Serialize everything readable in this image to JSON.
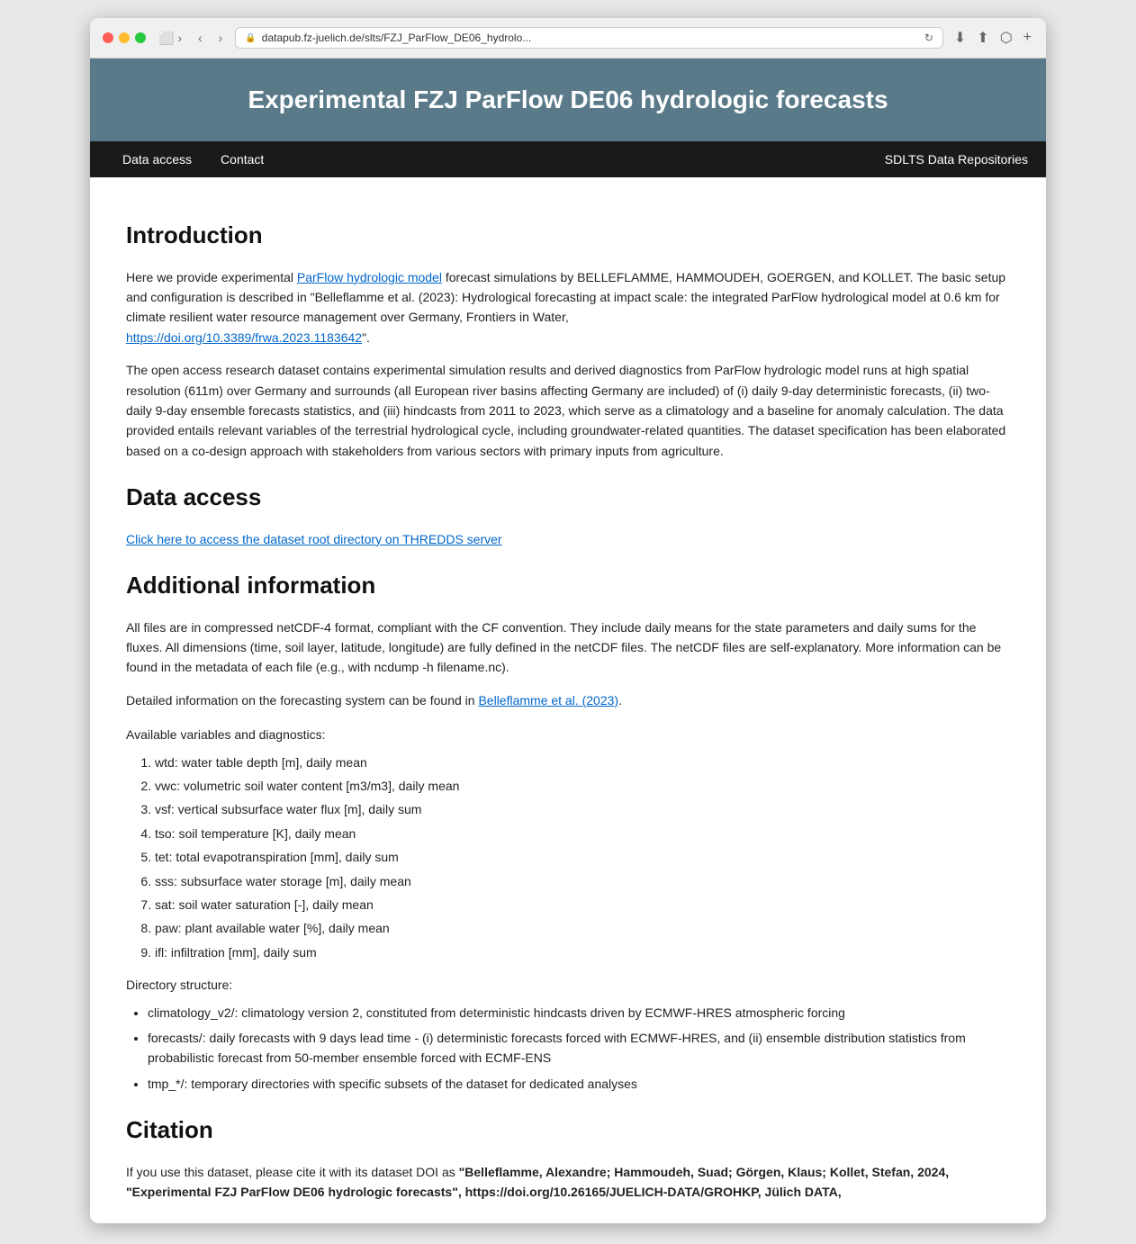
{
  "browser": {
    "url": "datapub.fz-juelich.de/slts/FZJ_ParFlow_DE06_hydrolo...",
    "back_label": "‹",
    "forward_label": "›",
    "home_label": "⌂",
    "history_label": "◷",
    "tab_label": "⬜",
    "download_label": "⬇",
    "share_label": "⬆",
    "copy_label": "⬡",
    "add_label": "+"
  },
  "page": {
    "title": "Experimental FZJ ParFlow DE06 hydrologic forecasts"
  },
  "nav": {
    "links": [
      {
        "label": "Data access"
      },
      {
        "label": "Contact"
      }
    ],
    "right": "SDLTS Data Repositories"
  },
  "sections": {
    "introduction": {
      "heading": "Introduction",
      "paragraph1_before": "Here we provide experimental ",
      "parflow_link": "ParFlow hydrologic model",
      "paragraph1_after": " forecast simulations by BELLEFLAMME, HAMMOUDEH, GOERGEN, and KOLLET. The basic setup and configuration is described in \"Belleflamme et al. (2023): Hydrological forecasting at impact scale: the integrated ParFlow hydrological model at 0.6 km for climate resilient water resource management over Germany, Frontiers in Water,",
      "doi_link": "https://doi.org/10.3389/frwa.2023.1183642",
      "paragraph1_end": "\".",
      "paragraph2": "The open access research dataset contains experimental simulation results and derived diagnostics from ParFlow hydrologic model runs at high spatial resolution (611m) over Germany and surrounds (all European river basins affecting Germany are included) of (i) daily 9-day deterministic forecasts, (ii) two-daily 9-day ensemble forecasts statistics, and (iii) hindcasts from 2011 to 2023, which serve as a climatology and a baseline for anomaly calculation. The data provided entails relevant variables of the terrestrial hydrological cycle, including groundwater-related quantities. The dataset specification has been elaborated based on a co-design approach with stakeholders from various sectors with primary inputs from agriculture."
    },
    "data_access": {
      "heading": "Data access",
      "link": "Click here to access the dataset root directory on THREDDS server"
    },
    "additional_info": {
      "heading": "Additional information",
      "paragraph1": "All files are in compressed netCDF-4 format, compliant with the CF convention. They include daily means for the state parameters and daily sums for the fluxes. All dimensions (time, soil layer, latitude, longitude) are fully defined in the netCDF files. The netCDF files are self-explanatory. More information can be found in the metadata of each file (e.g., with ncdump -h filename.nc).",
      "paragraph2_before": "Detailed information on the forecasting system can be found in ",
      "belleflamme_link": "Belleflamme et al. (2023)",
      "paragraph2_end": ".",
      "variables_label": "Available variables and diagnostics:",
      "variables": [
        "wtd: water table depth [m], daily mean",
        "vwc: volumetric soil water content [m3/m3], daily mean",
        "vsf: vertical subsurface water flux [m], daily sum",
        "tso: soil temperature [K], daily mean",
        "tet: total evapotranspiration [mm], daily sum",
        "sss: subsurface water storage [m], daily mean",
        "sat: soil water saturation [-], daily mean",
        "paw: plant available water [%], daily mean",
        "ifl: infiltration [mm], daily sum"
      ],
      "directory_label": "Directory structure:",
      "directories": [
        "climatology_v2/: climatology version 2, constituted from deterministic hindcasts driven by ECMWF-HRES atmospheric forcing",
        "forecasts/: daily forecasts with 9 days lead time - (i) deterministic forecasts forced with ECMWF-HRES, and (ii) ensemble distribution statistics from probabilistic forecast from 50-member ensemble forced with ECMF-ENS",
        "tmp_*/: temporary directories with specific subsets of the dataset for dedicated analyses"
      ]
    },
    "citation": {
      "heading": "Citation",
      "text_before": "If you use this dataset, please cite it with its dataset DOI as ",
      "citation_bold": "\"Belleflamme, Alexandre; Hammoudeh, Suad; Görgen, Klaus; Kollet, Stefan, 2024, \"Experimental FZJ ParFlow DE06 hydrologic forecasts\", https://doi.org/10.26165/JUELICH-DATA/GROHKP, Jülich DATA,"
    }
  }
}
